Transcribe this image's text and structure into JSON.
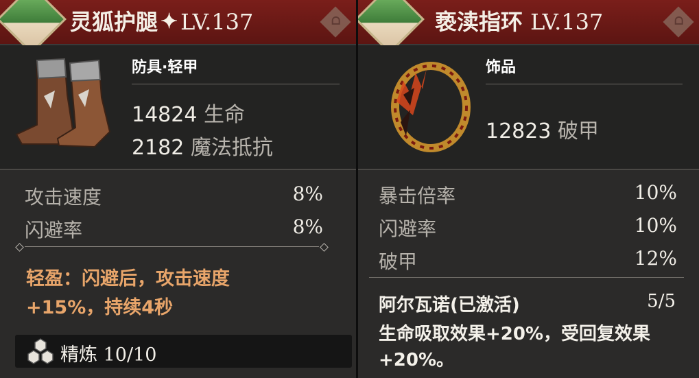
{
  "left_card": {
    "name": "灵狐护腿",
    "level": "LV.137",
    "category": "防具·轻甲",
    "main_stats": [
      {
        "value": "14824",
        "label": "生命"
      },
      {
        "value": "2182",
        "label": "魔法抵抗"
      }
    ],
    "sub_stats": [
      {
        "label": "攻击速度",
        "value": "8%"
      },
      {
        "label": "闪避率",
        "value": "8%"
      }
    ],
    "skill_text_line1": "轻盈：闪避后，攻击速度",
    "skill_text_line2": "+15%，持续4秒",
    "refine_label": "精炼 10/10",
    "icons": [
      "portrait-badge-icon",
      "star-icon",
      "lock-icon",
      "boots-icon",
      "refine-icon"
    ]
  },
  "right_card": {
    "name": "亵渎指环",
    "level": "LV.137",
    "category": "饰品",
    "main_stats": [
      {
        "value": "12823",
        "label": "破甲"
      }
    ],
    "sub_stats": [
      {
        "label": "暴击倍率",
        "value": "10%"
      },
      {
        "label": "闪避率",
        "value": "10%"
      },
      {
        "label": "破甲",
        "value": "12%"
      }
    ],
    "set_name": "阿尔瓦诺(已激活)",
    "set_count": "5/5",
    "set_desc_line1": "生命吸取效果+20%，受回复效果",
    "set_desc_line2": "+20%。",
    "icons": [
      "portrait-badge-icon",
      "lock-icon",
      "ring-icon"
    ]
  },
  "colors": {
    "header_red": "#7a1e1a",
    "panel": "#2b2a29",
    "skill_orange": "#e8a56a"
  }
}
